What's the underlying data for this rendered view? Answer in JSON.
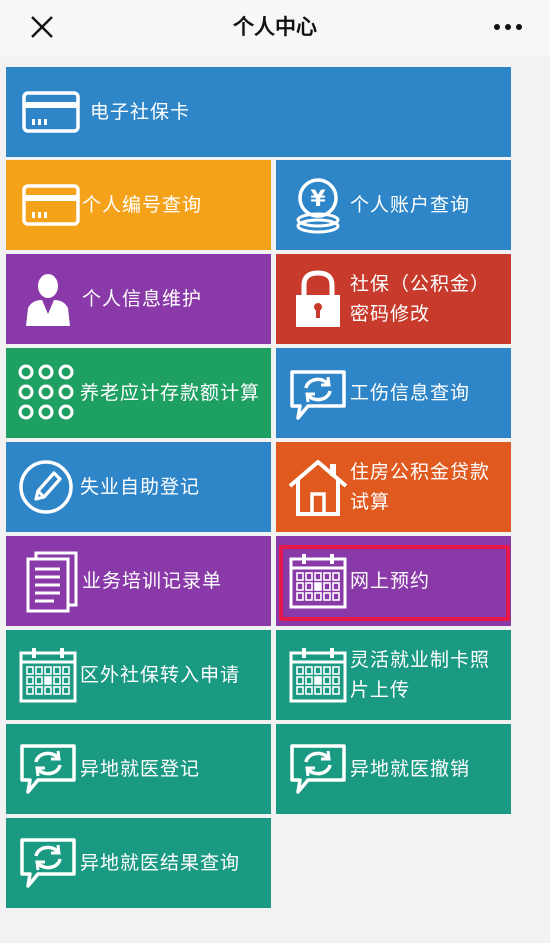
{
  "header": {
    "title": "个人中心"
  },
  "colors": {
    "blue": "#2e86c8",
    "orange": "#f5a21b",
    "purple": "#8a3aa8",
    "red": "#c83a2b",
    "green": "#1fa063",
    "deep_orange": "#e05a1f",
    "teal": "#1b9a83",
    "highlight_border": "#e3184b"
  },
  "tiles": [
    {
      "label": "电子社保卡",
      "icon": "card-icon",
      "color": "blue"
    },
    {
      "label": "个人编号查询",
      "icon": "card-icon",
      "color": "orange"
    },
    {
      "label": "个人账户查询",
      "icon": "yen-coin-icon",
      "color": "blue"
    },
    {
      "label": "个人信息维护",
      "icon": "person-icon",
      "color": "purple"
    },
    {
      "label": "社保（公积金）密码修改",
      "icon": "lock-icon",
      "color": "red"
    },
    {
      "label": "养老应计存款额计算",
      "icon": "dots-grid-icon",
      "color": "green"
    },
    {
      "label": "工伤信息查询",
      "icon": "refresh-chat-icon",
      "color": "blue"
    },
    {
      "label": "失业自助登记",
      "icon": "pencil-icon",
      "color": "blue"
    },
    {
      "label": "住房公积金贷款试算",
      "icon": "house-icon",
      "color": "deep_orange"
    },
    {
      "label": "业务培训记录单",
      "icon": "document-icon",
      "color": "purple"
    },
    {
      "label": "网上预约",
      "icon": "calendar-icon",
      "color": "purple"
    },
    {
      "label": "区外社保转入申请",
      "icon": "calendar-icon",
      "color": "teal"
    },
    {
      "label": "灵活就业制卡照片上传",
      "icon": "calendar-icon",
      "color": "teal"
    },
    {
      "label": "异地就医登记",
      "icon": "refresh-chat-icon",
      "color": "teal"
    },
    {
      "label": "异地就医撤销",
      "icon": "refresh-chat-icon",
      "color": "teal"
    },
    {
      "label": "异地就医结果查询",
      "icon": "refresh-chat-icon",
      "color": "teal"
    }
  ]
}
